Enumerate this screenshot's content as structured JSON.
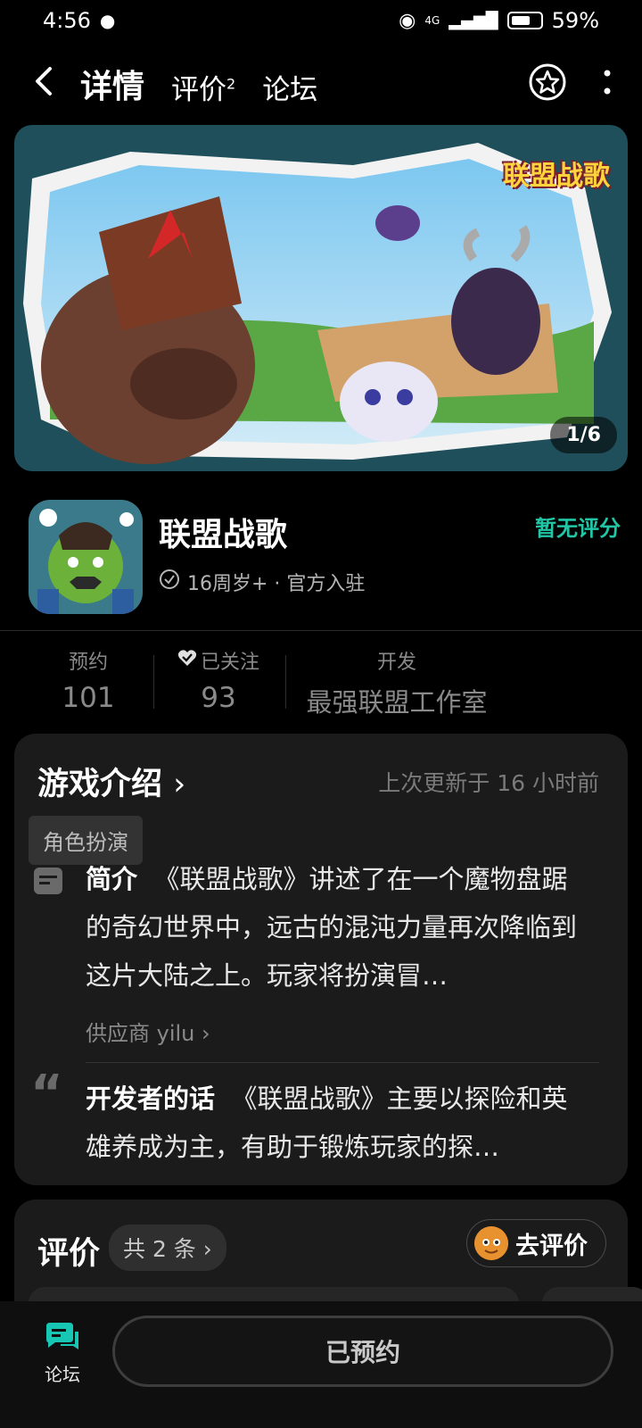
{
  "status_bar": {
    "time": "4:56",
    "network": "4G",
    "battery": "59%"
  },
  "nav": {
    "tabs": [
      {
        "label": "详情"
      },
      {
        "label": "评价",
        "badge": "2"
      },
      {
        "label": "论坛"
      }
    ]
  },
  "banner": {
    "logo_text": "联盟战歌",
    "pager": "1/6"
  },
  "game": {
    "title": "联盟战歌",
    "meta": "16周岁+ · 官方入驻",
    "rating": "暂无评分"
  },
  "stats": [
    {
      "label": "预约",
      "value": "101"
    },
    {
      "label": "已关注",
      "value": "93"
    },
    {
      "label": "开发",
      "value": "最强联盟工作室"
    }
  ],
  "intro": {
    "title": "游戏介绍",
    "updated": "上次更新于 16 小时前",
    "tag": "角色扮演",
    "summary_label": "简介",
    "summary_text": "《联盟战歌》讲述了在一个魔物盘踞的奇幻世界中，远古的混沌力量再次降临到这片大陆之上。玩家将扮演冒…",
    "supplier": "供应商 yilu",
    "dev_label": "开发者的话",
    "dev_text": "《联盟战歌》主要以探险和英雄养成为主，有助于锻炼玩家的探…"
  },
  "review": {
    "title": "评价",
    "count": "共 2 条",
    "write_label": "去评价"
  },
  "bottom": {
    "forum_label": "论坛",
    "reserve_label": "已预约"
  },
  "colors": {
    "accent": "#17c6b8",
    "rating": "#20c6a6",
    "background": "#000000",
    "card": "#1b1b1b"
  }
}
